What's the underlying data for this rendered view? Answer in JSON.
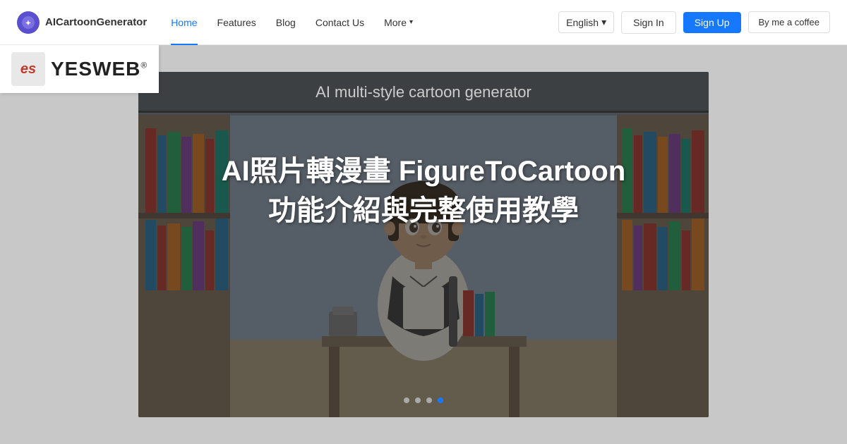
{
  "navbar": {
    "brand": {
      "name": "AICartoonGenerator",
      "icon_label": "✦"
    },
    "nav_items": [
      {
        "label": "Home",
        "active": true
      },
      {
        "label": "Features",
        "active": false
      },
      {
        "label": "Blog",
        "active": false
      },
      {
        "label": "Contact Us",
        "active": false
      },
      {
        "label": "More",
        "active": false,
        "has_chevron": true
      }
    ],
    "language": "English",
    "sign_in": "Sign In",
    "sign_up": "Sign Up",
    "coffee": "By me a coffee"
  },
  "yesweb": {
    "icon_text": "es",
    "name": "YESWEB",
    "registered": "®"
  },
  "blog_card": {
    "subtitle": "AI multi-style cartoon generator",
    "title_line1": "AI照片轉漫畫  FigureToCartoon",
    "title_line2": "功能介紹與完整使用教學"
  },
  "carousel": {
    "dots": [
      false,
      false,
      false,
      true
    ],
    "active_index": 3
  }
}
